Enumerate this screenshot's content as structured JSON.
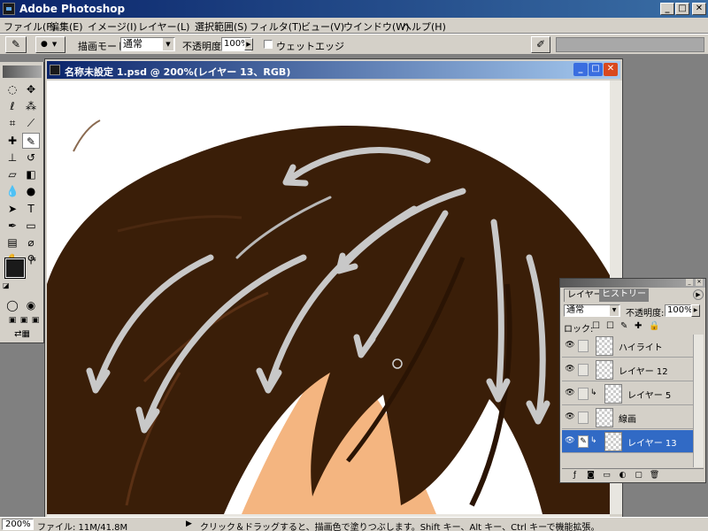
{
  "app": {
    "title": "Adobe Photoshop"
  },
  "window_controls": {
    "minimize": "_",
    "maximize": "□",
    "close": "✕"
  },
  "menu": [
    "ファイル(F)",
    "編集(E)",
    "イメージ(I)",
    "レイヤー(L)",
    "選択範囲(S)",
    "フィルタ(T)",
    "ビュー(V)",
    "ウインドウ(W)",
    "ヘルプ(H)"
  ],
  "options": {
    "mode_label": "描画モード:",
    "mode_value": "通常",
    "opacity_label": "不透明度:",
    "opacity_value": "100%",
    "wet_edges_label": "ウェットエッジ",
    "wet_edges_checked": false
  },
  "document": {
    "title": "名称未設定 1.psd @ 200%(レイヤー 13、RGB)",
    "hair_color": "#3a1e08",
    "skin_color": "#f4b580",
    "stroke_color": "#c8c8c8"
  },
  "layers_palette": {
    "tabs": [
      "レイヤー",
      "ヒストリー"
    ],
    "blend_mode": "通常",
    "opacity_label": "不透明度:",
    "opacity_value": "100%",
    "lock_label": "ロック:",
    "layers": [
      {
        "name": "ハイライト",
        "visible": true,
        "clipped": false,
        "selected": false
      },
      {
        "name": "レイヤー 12",
        "visible": true,
        "clipped": false,
        "selected": false
      },
      {
        "name": "レイヤー 5",
        "visible": true,
        "clipped": true,
        "selected": false
      },
      {
        "name": "線画",
        "visible": true,
        "clipped": false,
        "selected": false
      },
      {
        "name": "レイヤー 13",
        "visible": true,
        "clipped": true,
        "selected": true
      }
    ]
  },
  "status": {
    "zoom": "200%",
    "file_info": "ファイル: 11M/41.8M",
    "hint": "クリック＆ドラッグすると、描画色で塗りつぶします。Shift キー、Alt キー、Ctrl キーで機能拡張。"
  }
}
